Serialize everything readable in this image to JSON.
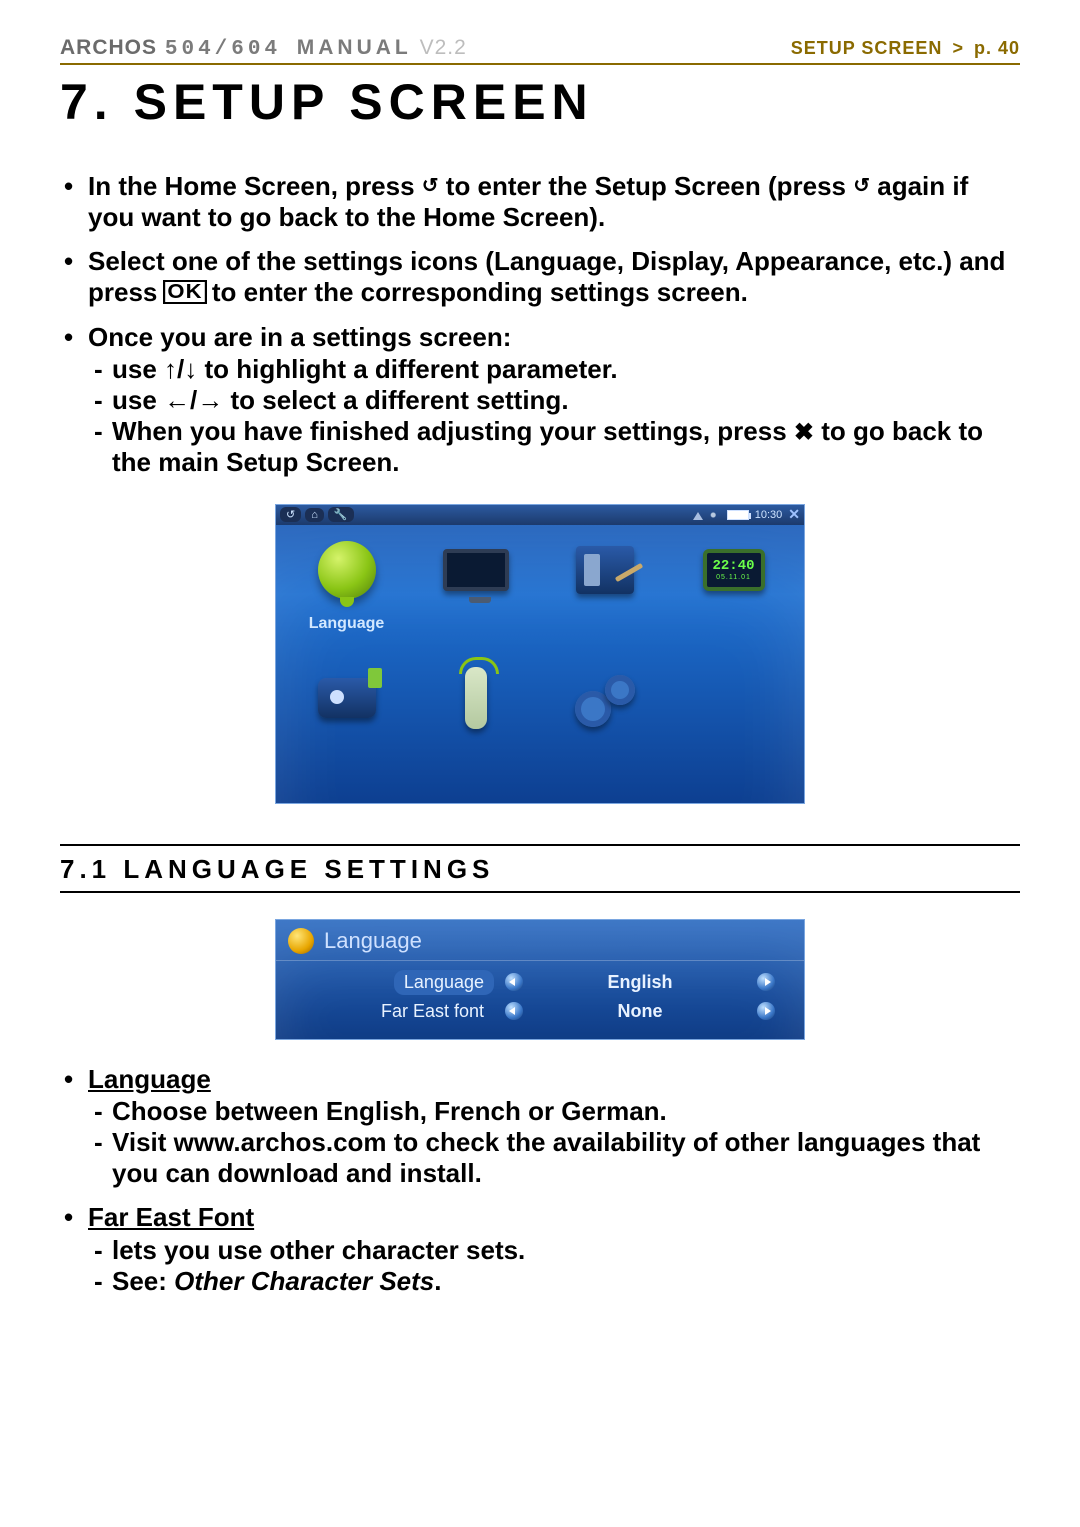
{
  "header": {
    "brand": "ARCHOS",
    "models": "504/604",
    "manual": "MANUAL",
    "version": "V2.2",
    "crumb_section": "SETUP SCREEN",
    "crumb_sep": ">",
    "crumb_page": "p. 40"
  },
  "title": "7. SETUP SCREEN",
  "instructions": {
    "line1a": "In the Home Screen, press ",
    "line1b": " to enter the Setup Screen (press ",
    "line1c": " again if you want to go back to the Home Screen).",
    "line2a": "Select one of the settings icons (Language, Display, Appearance, etc.) and press ",
    "line2b": " to enter the corresponding settings screen.",
    "ok_glyph": "OK",
    "line3": "Once you are in a settings screen:",
    "sub1": "use ↑/↓ to highlight a different parameter.",
    "sub2": "use ←/→ to select a different setting.",
    "sub3a": "When you have finished adjusting your settings, press ",
    "sub3b": " to go back to the main Setup Screen.",
    "close_glyph": "✖"
  },
  "setup_screenshot": {
    "status_time": "10:30",
    "clock_time": "22:40",
    "clock_date": "05.11.01",
    "label_language": "Language"
  },
  "section_71": {
    "heading": "7.1  LANGUAGE SETTINGS",
    "panel_title": "Language",
    "rows": [
      {
        "label": "Language",
        "value": "English"
      },
      {
        "label": "Far East font",
        "value": "None"
      }
    ],
    "body": {
      "lang_head": "Language",
      "lang_b1": "Choose between English, French or German.",
      "lang_b2": "Visit www.archos.com to check the availability of other languages that you can download and install.",
      "far_head": "Far East Font",
      "far_b1": "lets you use other character sets.",
      "far_b2a": "See: ",
      "far_b2b": "Other Character Sets",
      "far_b2c": "."
    }
  }
}
